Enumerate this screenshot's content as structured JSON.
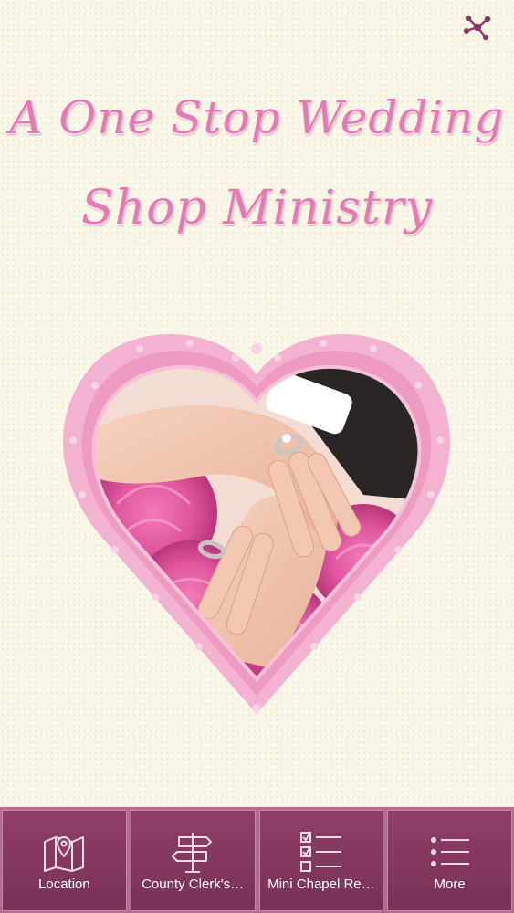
{
  "header": {
    "title_line1": "A One Stop Wedding",
    "title_line2": "Shop Ministry",
    "share_icon": "share-network-icon"
  },
  "hero": {
    "icon": "heart-frame-photo"
  },
  "tabbar": {
    "tabs": [
      {
        "label": "Location",
        "icon": "map-pin-icon"
      },
      {
        "label": "County Clerk's…",
        "icon": "signpost-icon"
      },
      {
        "label": "Mini Chapel Re…",
        "icon": "checklist-icon"
      },
      {
        "label": "More",
        "icon": "list-icon"
      }
    ]
  },
  "colors": {
    "background": "#fbf7e8",
    "title_pink": "#e779b6",
    "tab_bg": "#8f3f67",
    "frame_pink": "#f0a6c8",
    "share_icon": "#8a3a64"
  }
}
